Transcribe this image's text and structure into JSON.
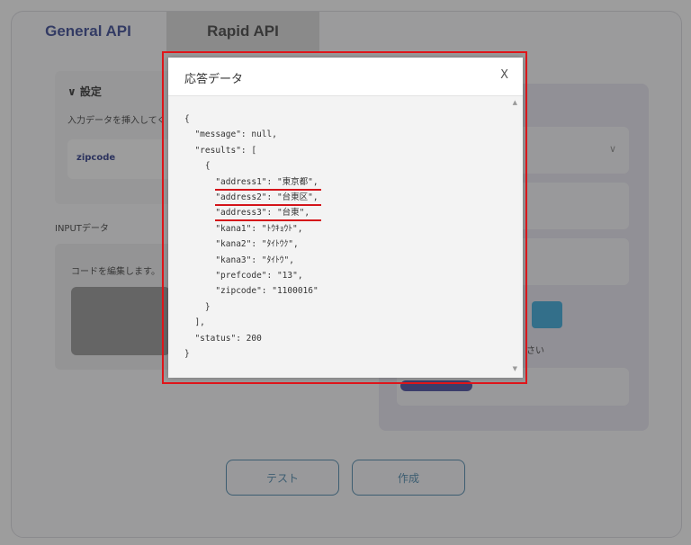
{
  "tabs": [
    {
      "label": "General API"
    },
    {
      "label": "Rapid API"
    }
  ],
  "settings": {
    "title": "∨ 設定",
    "description": "入力データを挿入してく",
    "field_label": "zipcode"
  },
  "input_section": {
    "title": "INPUTデータ",
    "edit_label": "コードを編集します。"
  },
  "right_panel": {
    "partial_text": "さい"
  },
  "buttons": {
    "test": "テスト",
    "create": "作成"
  },
  "dialog": {
    "title": "応答データ",
    "close": "X",
    "code_lines": [
      "{",
      "  \"message\": null,",
      "  \"results\": [",
      "    {",
      "      \"address1\": \"東京都\",",
      "      \"address2\": \"台東区\",",
      "      \"address3\": \"台東\",",
      "      \"kana1\": \"ﾄｳｷｮｳﾄ\",",
      "      \"kana2\": \"ﾀｲﾄｳｸ\",",
      "      \"kana3\": \"ﾀｲﾄｳ\",",
      "      \"prefcode\": \"13\",",
      "      \"zipcode\": \"1100016\"",
      "    }",
      "  ],",
      "  \"status\": 200",
      "}"
    ]
  },
  "colors": {
    "highlight": "#e0161b",
    "underline": "#d4141a",
    "tab_active": "#2b3a8c",
    "accent_blue": "#2aa3d9"
  }
}
